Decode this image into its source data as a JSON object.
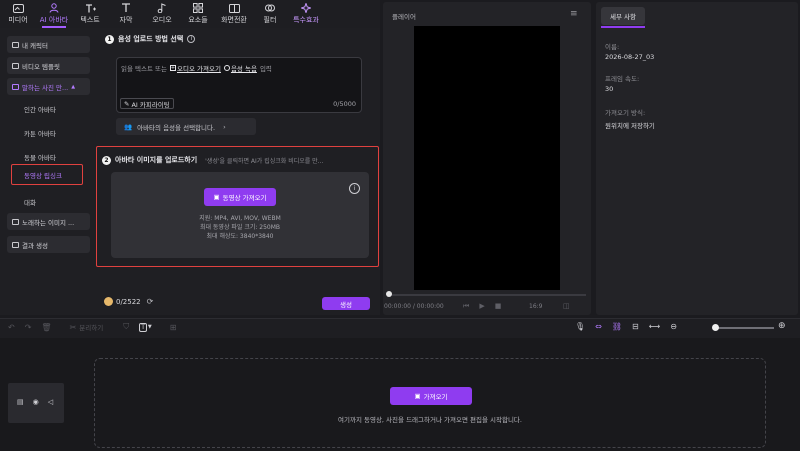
{
  "toolbar": {
    "items": [
      {
        "label": "미디어",
        "icon": "media-icon"
      },
      {
        "label": "AI 아바타",
        "icon": "avatar-icon",
        "active": true
      },
      {
        "label": "텍스트",
        "icon": "text-icon"
      },
      {
        "label": "자막",
        "icon": "caption-icon"
      },
      {
        "label": "오디오",
        "icon": "audio-icon"
      },
      {
        "label": "요소들",
        "icon": "elements-icon"
      },
      {
        "label": "화면전환",
        "icon": "transition-icon"
      },
      {
        "label": "필터",
        "icon": "filter-icon"
      },
      {
        "label": "특수효과",
        "icon": "effects-icon"
      }
    ]
  },
  "sidebar": {
    "items": [
      {
        "label": "내 캐릭터"
      },
      {
        "label": "비디오 템플릿"
      },
      {
        "label": "말하는 사진 만..."
      }
    ],
    "subitems": [
      "인간 아바타",
      "카툰 아바타",
      "동물 아바타",
      "동영상 립싱크",
      "대화"
    ],
    "bottom_items": [
      {
        "label": "노래하는 이미지 ..."
      },
      {
        "label": "결과 생성"
      }
    ]
  },
  "step1": {
    "title": "음성 업로드 방법 선택",
    "placeholder_pre": "읽을 텍스트 또는",
    "audio_import": "오디오 가져오기",
    "voice_record": "음성 녹음",
    "placeholder_post": "입력",
    "ai_copywriting": "AI 카피라이팅",
    "char_count": "0/5000",
    "voice_select": "아바타의 음성을 선택합니다."
  },
  "step2": {
    "title": "아바타 이미지를 업로드하기",
    "hint": "'생성'을 클릭하면 AI가 립싱크화 비디오를 만...",
    "import_button": "동영상 가져오기",
    "formats": "지원: MP4, AVI, MOV, WEBM",
    "max_size": "최대 동영상 파일 크기: 250MB",
    "max_resolution": "최대 해상도: 3840*3840"
  },
  "credits": "0/2522",
  "generate_button": "생성",
  "player": {
    "title": "플레이어",
    "time": "00:00:00 / 00:00:00",
    "ratio": "16:9"
  },
  "details": {
    "tab": "세부 사항",
    "name_label": "이름:",
    "name_value": "2026-08-27_03",
    "fps_label": "프레임 속도:",
    "fps_value": "30",
    "import_label": "가져오기 방식:",
    "import_value": "원위치에 저장하기"
  },
  "timeline": {
    "split_label": "분리하기",
    "import_button": "가져오기",
    "hint": "여기까지 동영상, 사진을 드래그하거나 가져오면 편집을 시작합니다."
  },
  "colors": {
    "accent": "#8f3cf0",
    "highlight_border": "#e0413f"
  }
}
